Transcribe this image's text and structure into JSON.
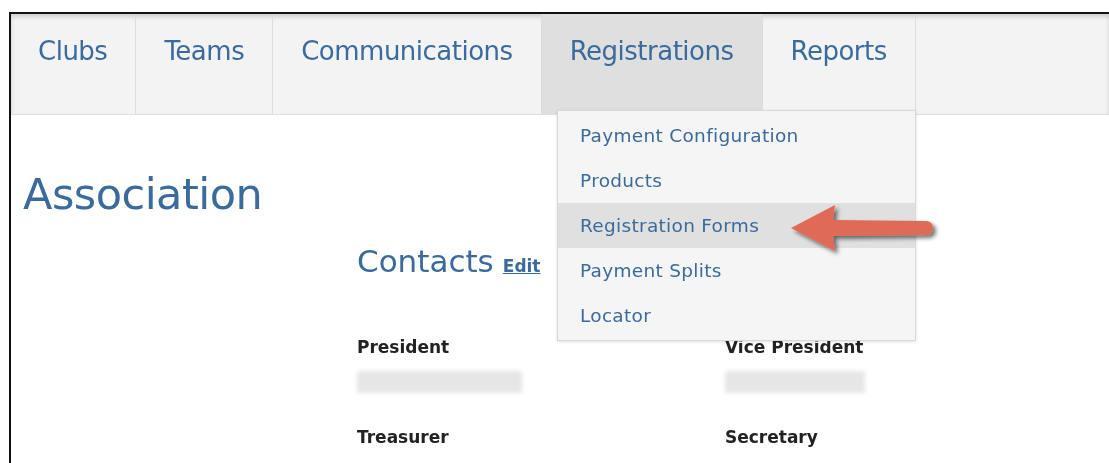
{
  "nav": {
    "tabs": [
      {
        "label": "Clubs",
        "selected": false
      },
      {
        "label": "Teams",
        "selected": false
      },
      {
        "label": "Communications",
        "selected": false
      },
      {
        "label": "Registrations",
        "selected": true
      },
      {
        "label": "Reports",
        "selected": false
      }
    ]
  },
  "dropdown": {
    "items": [
      {
        "label": "Payment Configuration",
        "selected": false
      },
      {
        "label": "Products",
        "selected": false
      },
      {
        "label": "Registration Forms",
        "selected": true
      },
      {
        "label": "Payment Splits",
        "selected": false
      },
      {
        "label": "Locator",
        "selected": false
      }
    ]
  },
  "page": {
    "heading": "Association",
    "contacts": {
      "title": "Contacts",
      "edit_link": "Edit",
      "roles": [
        {
          "label": "President"
        },
        {
          "label": "Vice President"
        },
        {
          "label": "Treasurer"
        },
        {
          "label": "Secretary"
        }
      ]
    }
  }
}
